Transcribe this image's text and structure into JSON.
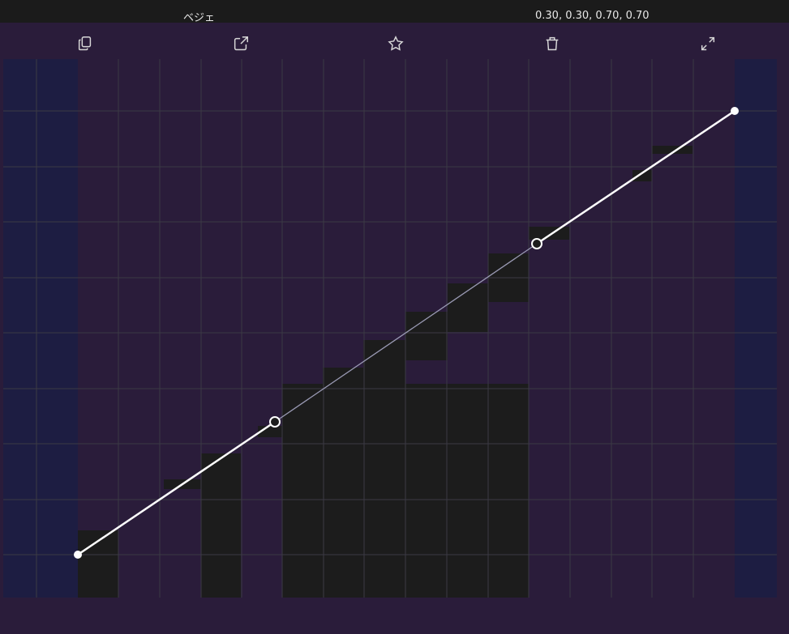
{
  "header": {
    "curve_name": "ベジェ",
    "curve_value": "0.30, 0.30, 0.70, 0.70"
  },
  "toolbar": {
    "buttons": [
      {
        "icon": "copy-icon"
      },
      {
        "icon": "export-icon"
      },
      {
        "icon": "star-icon"
      },
      {
        "icon": "trash-icon"
      },
      {
        "icon": "expand-icon"
      }
    ]
  },
  "curve": {
    "control_points": [
      0.3,
      0.3,
      0.7,
      0.7
    ],
    "colors": {
      "panel": "#2a1c3a",
      "side_columns": "#1d1d42",
      "dark_fill": "#1c1c1c",
      "grid": "#3a3a3a",
      "curve": "#ffffff",
      "handle_line": "#9a9ab0"
    }
  }
}
